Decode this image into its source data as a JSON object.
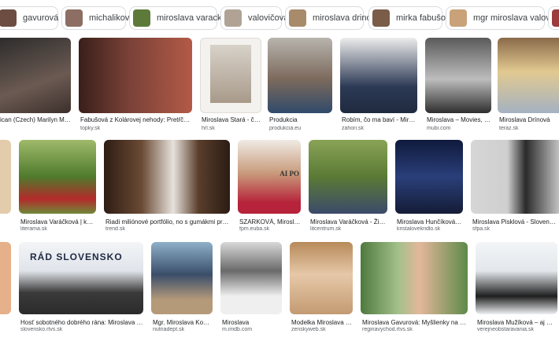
{
  "chips": [
    {
      "label": "gavurová",
      "color": "#6d4c41"
    },
    {
      "label": "michaliková",
      "color": "#8d6e63"
    },
    {
      "label": "miroslava varackova",
      "color": "#5d7a3a"
    },
    {
      "label": "valovičová",
      "color": "#b0a396"
    },
    {
      "label": "miroslava drinova",
      "color": "#a88b6a"
    },
    {
      "label": "mirka fabušová",
      "color": "#7a5c48"
    },
    {
      "label": "mgr miroslava valovicova",
      "color": "#c9a27a"
    },
    {
      "label": "",
      "color": "#9b3b3b"
    }
  ],
  "rows": [
    [
      {
        "caption": "xican (Czech) Marilyn Monro...",
        "source": "",
        "bg": "#5a4a44"
      },
      {
        "caption": "Fabušová z Kolárovej nehody: Pretŕča sa na ...",
        "source": "topky.sk",
        "bg": "#6b3a32"
      },
      {
        "caption": "Miroslava Stará - člení...",
        "source": "hrl.sk",
        "bg": "#e9e6e2"
      },
      {
        "caption": "Produkcia",
        "source": "produkcia.eu",
        "bg": "#c7c2bd"
      },
      {
        "caption": "Robím, čo ma baví - Miroslava...",
        "source": "zahori.sk",
        "bg": "#e6e6e6"
      },
      {
        "caption": "Miroslava – Movies, Bio ...",
        "source": "mubi.com",
        "bg": "#8c8c8c"
      },
      {
        "caption": "Miroslava Drínová",
        "source": "teraz.sk",
        "bg": "#c9b27c"
      }
    ],
    [
      {
        "caption": "t",
        "source": "",
        "bg": "#d9c3a5"
      },
      {
        "caption": "Miroslava Varáčková | knihku...",
        "source": "literama.sk",
        "bg": "#6f8e3d"
      },
      {
        "caption": "Riadi miliónové portfólio, no s gumákmi problém ne...",
        "source": "trend.sk",
        "bg": "#4a3427"
      },
      {
        "caption": "SZARKOVÁ, Miroslava, ...",
        "source": "fpm.euba.sk",
        "bg": "#e5e0d8"
      },
      {
        "caption": "Miroslava Varáčková - Životopi...",
        "source": "litcentrum.sk",
        "bg": "#7c8a45"
      },
      {
        "caption": "Miroslava Hunčíková - Kri...",
        "source": "kristalovekridlo.sk",
        "bg": "#1b2b55"
      },
      {
        "caption": "Miroslava Pisklová - Slovenská spolo...",
        "source": "sfpa.sk",
        "bg": "#d3d3d3"
      }
    ],
    [
      {
        "caption": "",
        "source": "",
        "bg": "#e6b08a"
      },
      {
        "caption": "Hosť sobotného dobrého rána: Miroslava Sawiris - ...",
        "source": "slovensko.rtvs.sk",
        "bg": "#e9edf2"
      },
      {
        "caption": "Mgr. Miroslava Konrád...",
        "source": "nutriadept.sk",
        "bg": "#9bb7c9"
      },
      {
        "caption": "Miroslava",
        "source": "m.imdb.com",
        "bg": "#cfcfcf"
      },
      {
        "caption": "Modelka Miroslava Fab...",
        "source": "zenskyweb.sk",
        "bg": "#d9b99a"
      },
      {
        "caption": "Miroslava Gavurová: Myšlienky na dnes - ...",
        "source": "reginavychod.rtvs.sk",
        "bg": "#6a8f5a"
      },
      {
        "caption": "Miroslava Mužíková – aj naš...",
        "source": "verejneobstaravania.sk",
        "bg": "#eef1f4"
      }
    ]
  ],
  "overlay_texts": {
    "row3_tile2_banner": "RÁD  SLOVENSKO",
    "row2_tile4_side": "AI  PO"
  }
}
